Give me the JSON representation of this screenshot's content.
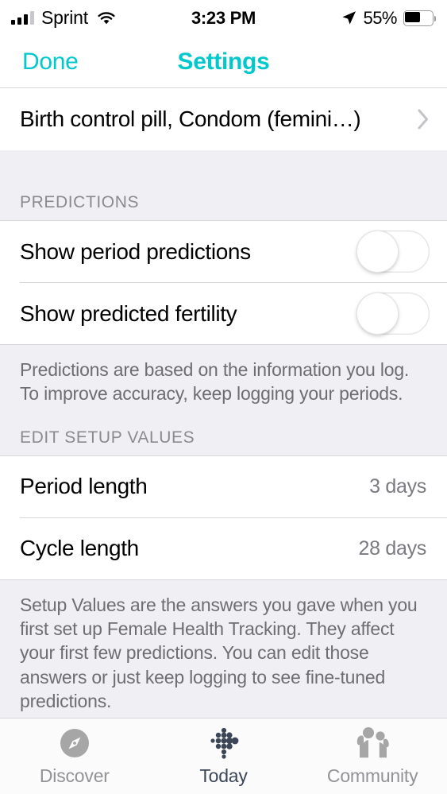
{
  "status_bar": {
    "carrier": "Sprint",
    "signal_bars_filled": 3,
    "signal_bars_total": 4,
    "wifi_icon": "wifi-icon",
    "time": "3:23 PM",
    "location_icon": "location-arrow-icon",
    "battery_percent_label": "55%",
    "battery_level": 55
  },
  "nav_bar": {
    "done_label": "Done",
    "title": "Settings",
    "accent_color": "#00c8cd"
  },
  "birth_control": {
    "label": "Birth control pill, Condom (femini…)",
    "chevron_icon": "chevron-right-icon"
  },
  "predictions": {
    "header": "PREDICTIONS",
    "rows": [
      {
        "label": "Show period predictions",
        "toggle_on": false
      },
      {
        "label": "Show predicted fertility",
        "toggle_on": false
      }
    ],
    "footer": "Predictions are based on the information you log. To improve accuracy, keep logging your periods."
  },
  "setup_values": {
    "header": "EDIT SETUP VALUES",
    "rows": [
      {
        "label": "Period length",
        "value": "3 days"
      },
      {
        "label": "Cycle length",
        "value": "28 days"
      }
    ],
    "footer": "Setup Values are the answers you gave when you first set up Female Health Tracking. They affect your first few predictions. You can edit those answers or just keep logging to see fine-tuned predictions."
  },
  "tab_bar": {
    "tabs": [
      {
        "label": "Discover",
        "icon": "compass-icon",
        "active": false
      },
      {
        "label": "Today",
        "icon": "dot-diamond-icon",
        "active": true
      },
      {
        "label": "Community",
        "icon": "people-icon",
        "active": false
      }
    ],
    "active_color": "#3c4657",
    "inactive_color": "#929297"
  }
}
